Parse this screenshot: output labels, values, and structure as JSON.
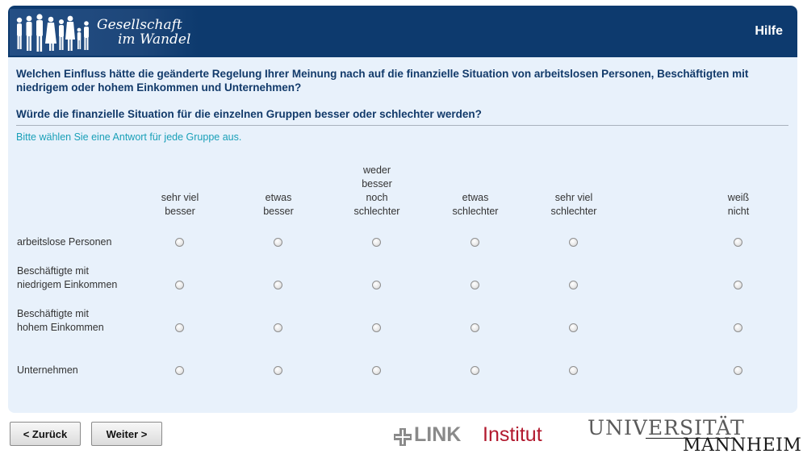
{
  "header": {
    "logo_line1": "Gesellschaft",
    "logo_line2": "im Wandel",
    "help_label": "Hilfe",
    "bg_color": "#0d3a6e"
  },
  "question": {
    "main": "Welchen Einfluss hätte die geänderte Regelung Ihrer Meinung nach auf die finanzielle Situation von arbeitslosen Personen, Beschäftigten mit niedrigem oder hohem Einkommen und Unternehmen?",
    "sub": "Würde die finanzielle Situation für die einzelnen Gruppen besser oder schlechter werden?",
    "instruction": "Bitte wählen Sie eine Antwort für jede Gruppe aus."
  },
  "grid": {
    "columns": [
      {
        "lines": [
          "sehr viel",
          "besser"
        ]
      },
      {
        "lines": [
          "etwas",
          "besser"
        ]
      },
      {
        "lines": [
          "weder",
          "besser",
          "noch",
          "schlechter"
        ]
      },
      {
        "lines": [
          "etwas",
          "schlechter"
        ]
      },
      {
        "lines": [
          "sehr viel",
          "schlechter"
        ]
      },
      {
        "lines": [
          "weiß",
          "nicht"
        ]
      }
    ],
    "rows": [
      {
        "lines": [
          "arbeitslose Personen"
        ],
        "selected": null
      },
      {
        "lines": [
          "Beschäftigte mit",
          "niedrigem Einkommen"
        ],
        "selected": null
      },
      {
        "lines": [
          "Beschäftigte mit",
          "hohem Einkommen"
        ],
        "selected": null
      },
      {
        "lines": [
          "Unternehmen"
        ],
        "selected": null
      }
    ]
  },
  "nav": {
    "back_label": "< Zurück",
    "next_label": "Weiter >"
  },
  "footer": {
    "link_word": "LINK",
    "link_institut": "Institut",
    "uni_line1": "UNIVERSITÄT",
    "uni_line2": "MANNHEIM",
    "link_red": "#b2192e"
  }
}
